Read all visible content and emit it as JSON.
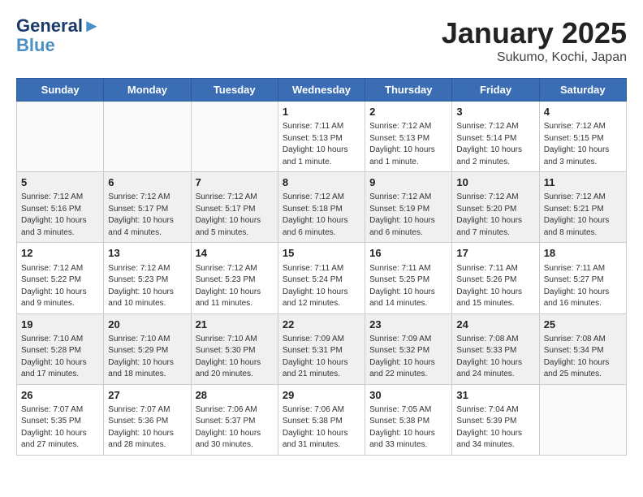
{
  "header": {
    "logo_line1": "General",
    "logo_line2": "Blue",
    "title": "January 2025",
    "subtitle": "Sukumo, Kochi, Japan"
  },
  "weekdays": [
    "Sunday",
    "Monday",
    "Tuesday",
    "Wednesday",
    "Thursday",
    "Friday",
    "Saturday"
  ],
  "weeks": [
    [
      {
        "day": "",
        "info": ""
      },
      {
        "day": "",
        "info": ""
      },
      {
        "day": "",
        "info": ""
      },
      {
        "day": "1",
        "info": "Sunrise: 7:11 AM\nSunset: 5:13 PM\nDaylight: 10 hours\nand 1 minute."
      },
      {
        "day": "2",
        "info": "Sunrise: 7:12 AM\nSunset: 5:13 PM\nDaylight: 10 hours\nand 1 minute."
      },
      {
        "day": "3",
        "info": "Sunrise: 7:12 AM\nSunset: 5:14 PM\nDaylight: 10 hours\nand 2 minutes."
      },
      {
        "day": "4",
        "info": "Sunrise: 7:12 AM\nSunset: 5:15 PM\nDaylight: 10 hours\nand 3 minutes."
      }
    ],
    [
      {
        "day": "5",
        "info": "Sunrise: 7:12 AM\nSunset: 5:16 PM\nDaylight: 10 hours\nand 3 minutes."
      },
      {
        "day": "6",
        "info": "Sunrise: 7:12 AM\nSunset: 5:17 PM\nDaylight: 10 hours\nand 4 minutes."
      },
      {
        "day": "7",
        "info": "Sunrise: 7:12 AM\nSunset: 5:17 PM\nDaylight: 10 hours\nand 5 minutes."
      },
      {
        "day": "8",
        "info": "Sunrise: 7:12 AM\nSunset: 5:18 PM\nDaylight: 10 hours\nand 6 minutes."
      },
      {
        "day": "9",
        "info": "Sunrise: 7:12 AM\nSunset: 5:19 PM\nDaylight: 10 hours\nand 6 minutes."
      },
      {
        "day": "10",
        "info": "Sunrise: 7:12 AM\nSunset: 5:20 PM\nDaylight: 10 hours\nand 7 minutes."
      },
      {
        "day": "11",
        "info": "Sunrise: 7:12 AM\nSunset: 5:21 PM\nDaylight: 10 hours\nand 8 minutes."
      }
    ],
    [
      {
        "day": "12",
        "info": "Sunrise: 7:12 AM\nSunset: 5:22 PM\nDaylight: 10 hours\nand 9 minutes."
      },
      {
        "day": "13",
        "info": "Sunrise: 7:12 AM\nSunset: 5:23 PM\nDaylight: 10 hours\nand 10 minutes."
      },
      {
        "day": "14",
        "info": "Sunrise: 7:12 AM\nSunset: 5:23 PM\nDaylight: 10 hours\nand 11 minutes."
      },
      {
        "day": "15",
        "info": "Sunrise: 7:11 AM\nSunset: 5:24 PM\nDaylight: 10 hours\nand 12 minutes."
      },
      {
        "day": "16",
        "info": "Sunrise: 7:11 AM\nSunset: 5:25 PM\nDaylight: 10 hours\nand 14 minutes."
      },
      {
        "day": "17",
        "info": "Sunrise: 7:11 AM\nSunset: 5:26 PM\nDaylight: 10 hours\nand 15 minutes."
      },
      {
        "day": "18",
        "info": "Sunrise: 7:11 AM\nSunset: 5:27 PM\nDaylight: 10 hours\nand 16 minutes."
      }
    ],
    [
      {
        "day": "19",
        "info": "Sunrise: 7:10 AM\nSunset: 5:28 PM\nDaylight: 10 hours\nand 17 minutes."
      },
      {
        "day": "20",
        "info": "Sunrise: 7:10 AM\nSunset: 5:29 PM\nDaylight: 10 hours\nand 18 minutes."
      },
      {
        "day": "21",
        "info": "Sunrise: 7:10 AM\nSunset: 5:30 PM\nDaylight: 10 hours\nand 20 minutes."
      },
      {
        "day": "22",
        "info": "Sunrise: 7:09 AM\nSunset: 5:31 PM\nDaylight: 10 hours\nand 21 minutes."
      },
      {
        "day": "23",
        "info": "Sunrise: 7:09 AM\nSunset: 5:32 PM\nDaylight: 10 hours\nand 22 minutes."
      },
      {
        "day": "24",
        "info": "Sunrise: 7:08 AM\nSunset: 5:33 PM\nDaylight: 10 hours\nand 24 minutes."
      },
      {
        "day": "25",
        "info": "Sunrise: 7:08 AM\nSunset: 5:34 PM\nDaylight: 10 hours\nand 25 minutes."
      }
    ],
    [
      {
        "day": "26",
        "info": "Sunrise: 7:07 AM\nSunset: 5:35 PM\nDaylight: 10 hours\nand 27 minutes."
      },
      {
        "day": "27",
        "info": "Sunrise: 7:07 AM\nSunset: 5:36 PM\nDaylight: 10 hours\nand 28 minutes."
      },
      {
        "day": "28",
        "info": "Sunrise: 7:06 AM\nSunset: 5:37 PM\nDaylight: 10 hours\nand 30 minutes."
      },
      {
        "day": "29",
        "info": "Sunrise: 7:06 AM\nSunset: 5:38 PM\nDaylight: 10 hours\nand 31 minutes."
      },
      {
        "day": "30",
        "info": "Sunrise: 7:05 AM\nSunset: 5:38 PM\nDaylight: 10 hours\nand 33 minutes."
      },
      {
        "day": "31",
        "info": "Sunrise: 7:04 AM\nSunset: 5:39 PM\nDaylight: 10 hours\nand 34 minutes."
      },
      {
        "day": "",
        "info": ""
      }
    ]
  ]
}
